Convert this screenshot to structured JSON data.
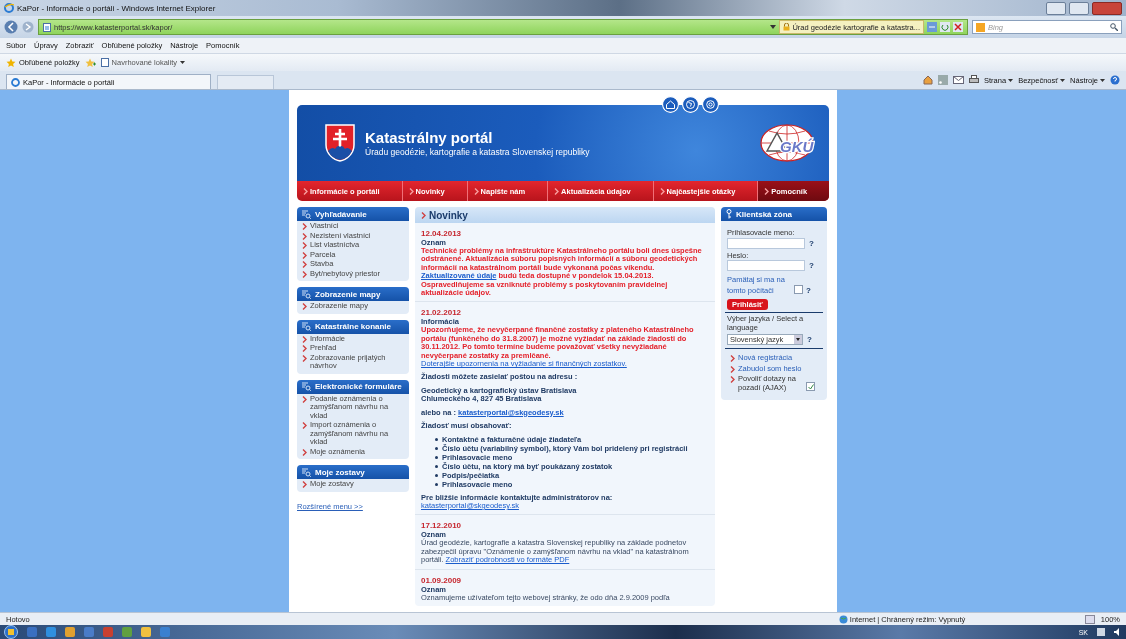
{
  "browser": {
    "window_title": "KaPor - Informácie o portáli - Windows Internet Explorer",
    "address": "https://www.katasterportal.sk/kapor/",
    "site_label": "Úrad geodézie kartografie a katastra...",
    "search_placeholder": "Bing",
    "menu": [
      "Súbor",
      "Úpravy",
      "Zobraziť",
      "Obľúbené položky",
      "Nástroje",
      "Pomocník"
    ],
    "favorites_label": "Obľúbené položky",
    "suggested_sites": "Navrhované lokality",
    "tab_title": "KaPor - Informácie o portáli",
    "commands": [
      "Strana",
      "Bezpečnosť",
      "Nástroje"
    ]
  },
  "header": {
    "title": "Katastrálny portál",
    "subtitle": "Úradu geodézie, kartografie a katastra Slovenskej republiky",
    "logo_text": "GKÚ"
  },
  "nav": [
    {
      "label": "Informácie o portáli",
      "selected": false
    },
    {
      "label": "Novinky",
      "selected": false
    },
    {
      "label": "Napište nám",
      "selected": false
    },
    {
      "label": "Aktualizácia údajov",
      "selected": false
    },
    {
      "label": "Najčastejšie otázky",
      "selected": false
    },
    {
      "label": "Pomocník",
      "selected": true
    }
  ],
  "sidebar": {
    "sections": [
      {
        "title": "Vyhľadávanie",
        "items": [
          "Vlastníci",
          "Nezistení vlastníci",
          "List vlastníctva",
          "Parcela",
          "Stavba",
          "Byt/nebytový priestor"
        ]
      },
      {
        "title": "Zobrazenie mapy",
        "items": [
          "Zobrazenie mapy"
        ]
      },
      {
        "title": "Katastrálne konanie",
        "items": [
          "Informácie",
          "Prehľad",
          "Zobrazovanie prijatých návrhov"
        ]
      },
      {
        "title": "Elektronické formuláre",
        "items": [
          "Podanie oznámenia o zamýšľanom návrhu na vklad",
          "Import oznámenia o zamýšľanom návrhu na vklad",
          "Moje oznámenia"
        ]
      },
      {
        "title": "Moje zostavy",
        "items": [
          "Moje zostavy"
        ]
      }
    ],
    "extended_menu": "Rozšírené menu >>"
  },
  "news": {
    "heading": "Novinky",
    "items": [
      {
        "date": "12.04.2013",
        "category": "Oznam",
        "blocks": [
          {
            "kind": "alert",
            "segments": [
              {
                "kind": "text",
                "text": "Technické problémy na infraštruktúre Katastrálneho portálu boli dnes úspešne odstránené. Aktualizácia súboru popisných informácií a súboru geodetických informácií na katastrálnom portáli bude vykonaná počas víkendu. "
              },
              {
                "kind": "link",
                "text": "Zaktualizované údaje"
              },
              {
                "kind": "text",
                "text": " budú teda dostupné v pondelok 15.04.2013. Ospravedlňujeme sa vzniknuté problémy s poskytovaním pravidelnej aktualizácie údajov."
              }
            ]
          }
        ]
      },
      {
        "date": "21.02.2012",
        "category": "Informácia",
        "blocks": [
          {
            "kind": "alert",
            "segments": [
              {
                "kind": "text",
                "text": "Upozorňujeme, že nevyčerpané finančné zostatky z plateného Katastrálneho portálu (funkčného do 31.8.2007) je možné vyžiadať na základe žiadosti do 30.11.2012. Po tomto termíne budeme považovať všetky nevyžiadané nevyčerpané zostatky za premlčané."
              }
            ]
          },
          {
            "kind": "link",
            "segments": [
              {
                "kind": "link",
                "text": "Doterajšie upozornenia na vyžiadanie si finančných zostatkov."
              }
            ]
          },
          {
            "kind": "note",
            "segments": [
              {
                "kind": "text",
                "text": "Žiadosti môžete zasielať poštou na adresu :"
              }
            ]
          },
          {
            "kind": "address",
            "lines": [
              "Geodetický a kartografický ústav Bratislava",
              "Chlumeckého 4, 827 45 Bratislava"
            ]
          },
          {
            "kind": "note",
            "segments": [
              {
                "kind": "text",
                "text": "alebo na : "
              },
              {
                "kind": "link",
                "text": "katasterportal@skgeodesy.sk"
              }
            ]
          },
          {
            "kind": "note",
            "segments": [
              {
                "kind": "text",
                "text": "Žiadosť musí obsahovať:"
              }
            ]
          },
          {
            "kind": "list",
            "lines": [
              "Kontaktné a fakturačné údaje žiadateľa",
              "Číslo účtu (variabilný symbol), ktorý Vám bol pridelený pri registrácii",
              "Prihlasovacie meno",
              "Číslo účtu, na ktorý má byť poukázaný zostatok",
              "Podpis/pečiatka",
              "Prihlasovacie meno"
            ]
          },
          {
            "kind": "note",
            "segments": [
              {
                "kind": "text",
                "text": "Pre bližšie informácie kontaktujte administrátorov na:"
              }
            ]
          },
          {
            "kind": "link",
            "segments": [
              {
                "kind": "link",
                "text": "katasterportal@skgeodesy.sk"
              }
            ]
          }
        ]
      },
      {
        "date": "17.12.2010",
        "category": "Oznam",
        "blocks": [
          {
            "kind": "plain",
            "segments": [
              {
                "kind": "text",
                "text": "Úrad geodézie, kartografie a katastra Slovenskej republiky na základe podnetov zabezpečil úpravu \"Oznámenie o zamýšľanom návrhu na vklad\" na katastrálnom portáli. "
              },
              {
                "kind": "link",
                "text": "Zobraziť podrobnosti vo formáte PDF"
              }
            ]
          }
        ]
      },
      {
        "date": "01.09.2009",
        "category": "Oznam",
        "blocks": [
          {
            "kind": "plain",
            "segments": [
              {
                "kind": "text",
                "text": "Oznamujeme užívateľom tejto webovej stránky, že odo dňa 2.9.2009 podľa"
              }
            ]
          }
        ]
      }
    ]
  },
  "client_zone": {
    "title": "Klientská zóna",
    "login_label": "Prihlasovacie meno:",
    "password_label": "Heslo:",
    "help": "?",
    "remember": {
      "label": "Pamätaj si ma na tomto počítači",
      "checked": false
    },
    "login_button": "Prihlásiť",
    "language_label": "Výber jazyka / Select a language",
    "language_value": "Slovenský jazyk",
    "links": [
      "Nová registrácia",
      "Zabudol som heslo"
    ],
    "ajax": {
      "label": "Povoliť dotazy na pozadí (AJAX)",
      "checked": true
    }
  },
  "status_bar": {
    "status": "Hotovo",
    "zone": "Internet | Chránený režim: Vypnutý",
    "zoom": "100%"
  },
  "taskbar": {
    "language": "SK"
  }
}
